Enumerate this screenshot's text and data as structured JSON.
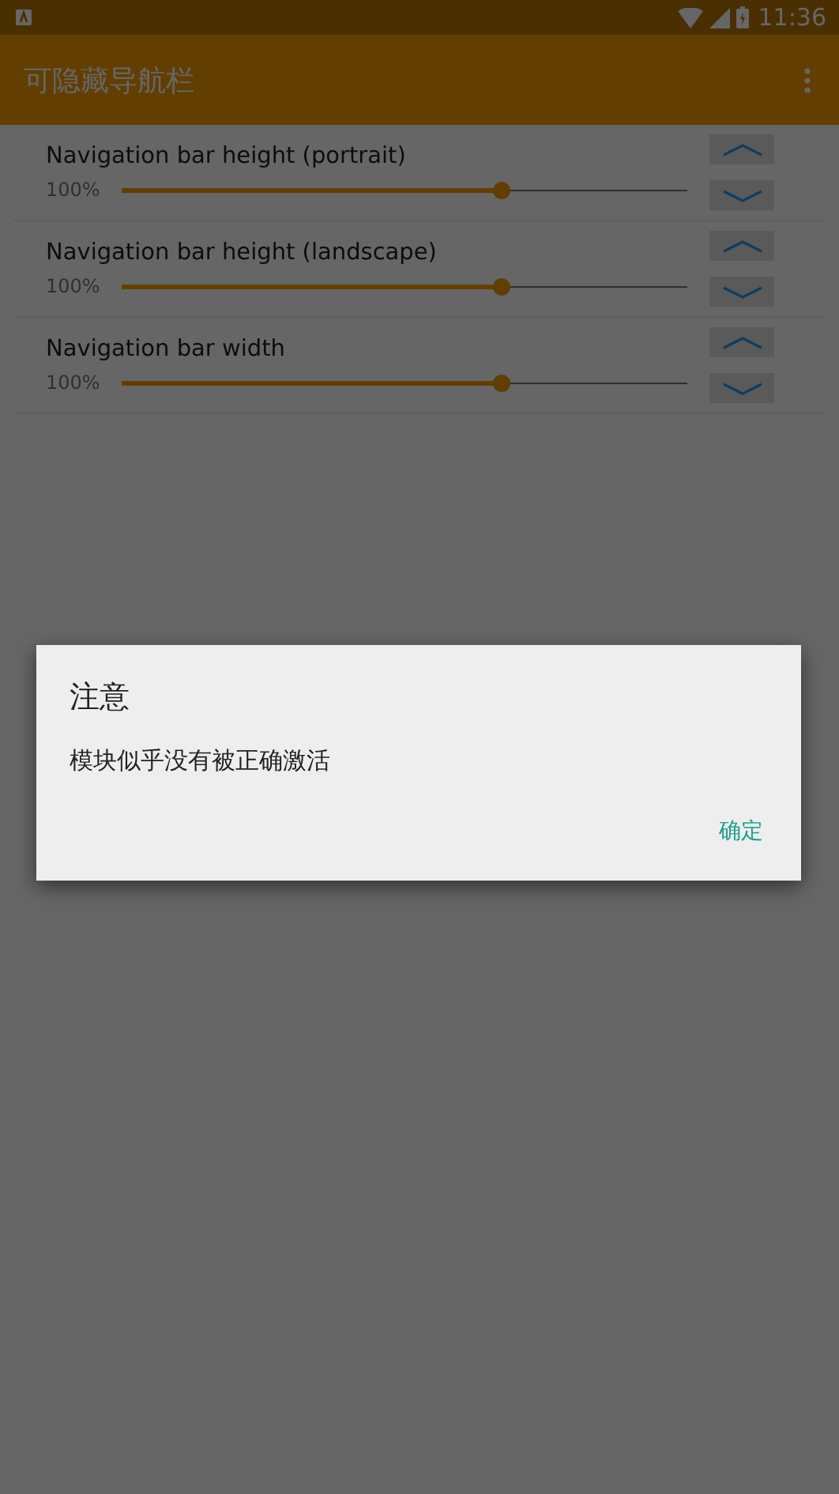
{
  "status_bar": {
    "time": "11:36"
  },
  "app_bar": {
    "title": "可隐藏导航栏"
  },
  "settings": [
    {
      "label": "Navigation bar height (portrait)",
      "value": "100%",
      "level": 0.67
    },
    {
      "label": "Navigation bar height (landscape)",
      "value": "100%",
      "level": 0.67
    },
    {
      "label": "Navigation bar width",
      "value": "100%",
      "level": 0.67
    }
  ],
  "dialog": {
    "title": "注意",
    "message": "模块似乎没有被正确激活",
    "button": "确定"
  }
}
